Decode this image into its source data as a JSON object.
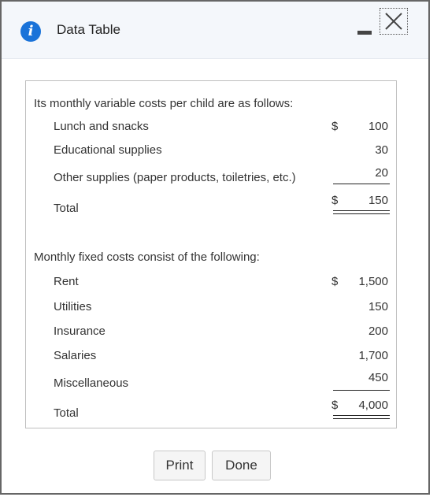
{
  "window": {
    "title": "Data Table",
    "icons": {
      "info": "info-icon",
      "minimize": "minimize-icon",
      "close": "close-icon"
    }
  },
  "variable_costs": {
    "heading": "Its monthly variable costs per child are as follows:",
    "rows": [
      {
        "label": "Lunch and snacks",
        "currency": "$",
        "value": "100"
      },
      {
        "label": "Educational supplies",
        "currency": "",
        "value": "30"
      },
      {
        "label": "Other supplies (paper products, toiletries, etc.)",
        "currency": "",
        "value": "20"
      }
    ],
    "total": {
      "label": "Total",
      "currency": "$",
      "value": "150"
    }
  },
  "fixed_costs": {
    "heading": "Monthly fixed costs consist of the following:",
    "rows": [
      {
        "label": "Rent",
        "currency": "$",
        "value": "1,500"
      },
      {
        "label": "Utilities",
        "currency": "",
        "value": "150"
      },
      {
        "label": "Insurance",
        "currency": "",
        "value": "200"
      },
      {
        "label": "Salaries",
        "currency": "",
        "value": "1,700"
      },
      {
        "label": "Miscellaneous",
        "currency": "",
        "value": "450"
      }
    ],
    "total": {
      "label": "Total",
      "currency": "$",
      "value": "4,000"
    }
  },
  "buttons": {
    "print": "Print",
    "done": "Done"
  },
  "colors": {
    "info_icon": "#1a73d9",
    "titlebar_bg": "#f4f7fb",
    "dialog_border": "#666666"
  }
}
